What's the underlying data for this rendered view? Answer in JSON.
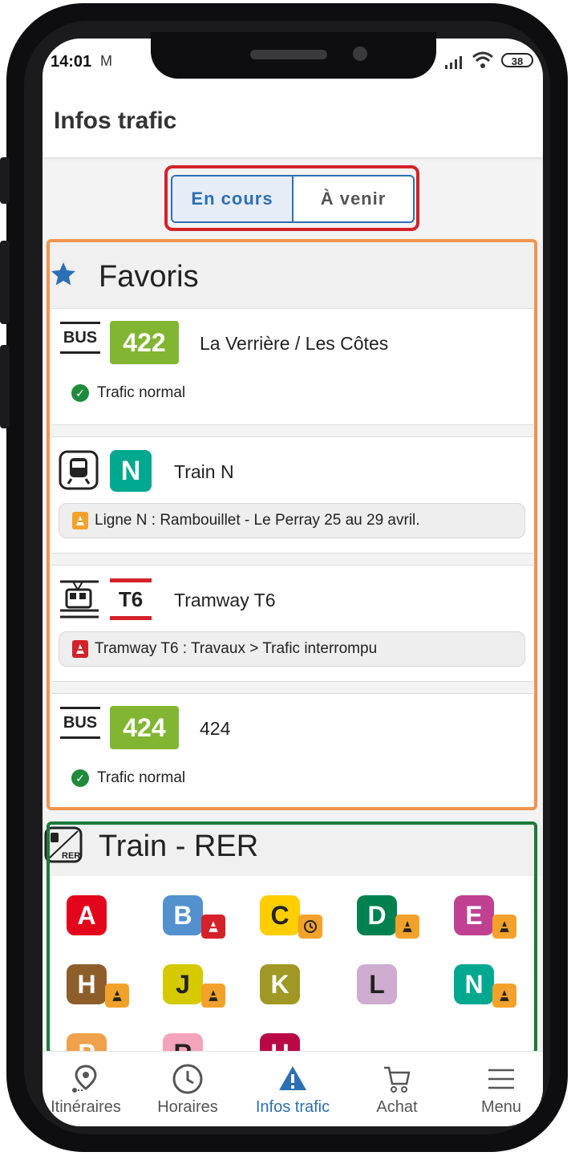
{
  "status_bar": {
    "time": "14:01",
    "battery": "38"
  },
  "header": {
    "title": "Infos trafic"
  },
  "tabs": {
    "current": "En cours",
    "upcoming": "À venir"
  },
  "favorites": {
    "title": "Favoris",
    "items": [
      {
        "mode": "BUS",
        "line": "422",
        "line_color": "#82b532",
        "name": "La Verrière / Les Côtes",
        "status": "Trafic normal"
      },
      {
        "mode": "train-icon",
        "line": "N",
        "line_color": "#00a88f",
        "name": "Train N",
        "alert": "Ligne N : Rambouillet - Le Perray 25 au 29 avril.",
        "alert_color": "#f2a22b"
      },
      {
        "mode": "tram-icon",
        "line": "T6",
        "line_color": "#d5212a",
        "name": "Tramway T6",
        "alert": "Tramway T6 : Travaux > Trafic interrompu",
        "alert_color": "#d5212a"
      },
      {
        "mode": "BUS",
        "line": "424",
        "line_color": "#82b532",
        "name": "424",
        "status": "Trafic normal"
      }
    ]
  },
  "rer": {
    "title": "Train - RER",
    "lines": [
      {
        "label": "A",
        "color": "#e3051b",
        "mini": ""
      },
      {
        "label": "B",
        "color": "#5291ce",
        "mini": "red-works"
      },
      {
        "label": "C",
        "color": "#ffce00",
        "mini": "orange-clock"
      },
      {
        "label": "D",
        "color": "#00814f",
        "mini": "orange-works"
      },
      {
        "label": "E",
        "color": "#c04191",
        "mini": "orange-works"
      },
      {
        "label": "H",
        "color": "#8d5e2a",
        "mini": "orange-works"
      },
      {
        "label": "J",
        "color": "#d5c900",
        "mini": "orange-works"
      },
      {
        "label": "K",
        "color": "#9f9825",
        "mini": ""
      },
      {
        "label": "L",
        "color": "#cdaccf",
        "mini": ""
      },
      {
        "label": "N",
        "color": "#00a88f",
        "mini": "orange-works"
      },
      {
        "label": "P",
        "color": "#f0a14b",
        "mini": ""
      },
      {
        "label": "R",
        "color": "#f3a4ba",
        "mini": ""
      },
      {
        "label": "U",
        "color": "#b90845",
        "mini": ""
      }
    ]
  },
  "bottom_nav": [
    {
      "label": "Itinéraires",
      "icon": "map-pin-icon",
      "active": false
    },
    {
      "label": "Horaires",
      "icon": "clock-icon",
      "active": false
    },
    {
      "label": "Infos trafic",
      "icon": "warning-icon",
      "active": true
    },
    {
      "label": "Achat",
      "icon": "cart-icon",
      "active": false
    },
    {
      "label": "Menu",
      "icon": "menu-icon",
      "active": false
    }
  ],
  "colors": {
    "accent": "#2b6fb5",
    "ok": "#1f8a3b"
  }
}
